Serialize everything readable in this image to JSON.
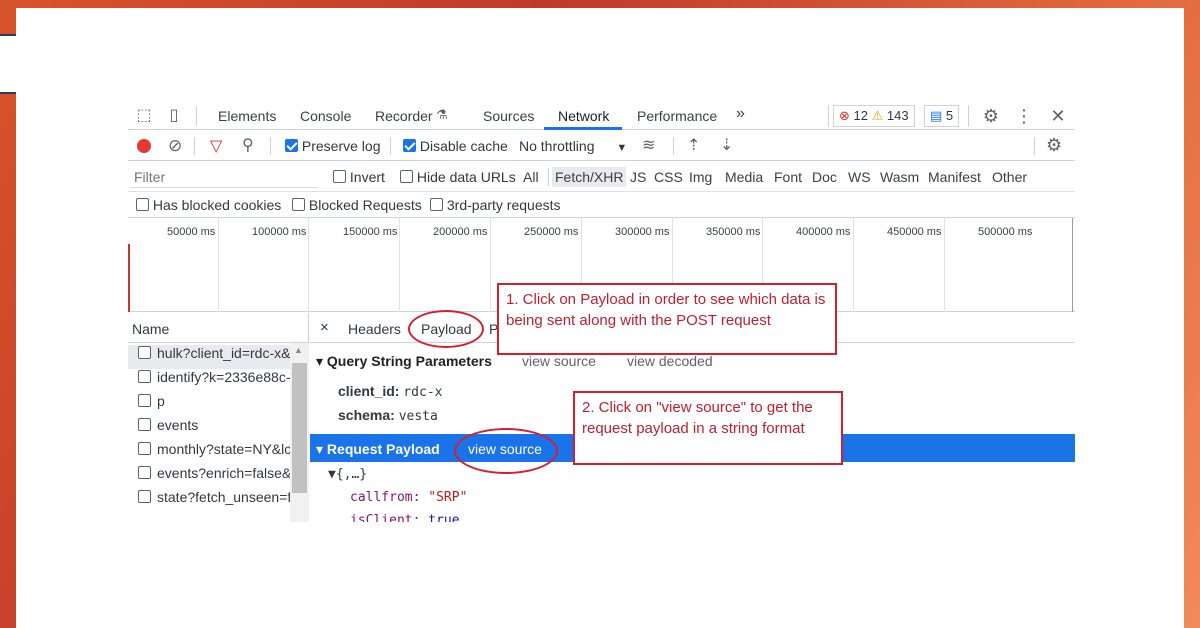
{
  "devtools": {
    "tabs": [
      "Elements",
      "Console",
      "Recorder",
      "Sources",
      "Network",
      "Performance"
    ],
    "active_tab": "Network",
    "more_tabs": "»",
    "errors_count": "12",
    "warnings_count": "143",
    "messages_count": "5",
    "toolbar": {
      "preserve_log": "Preserve log",
      "disable_cache": "Disable cache",
      "throttling": "No throttling"
    },
    "filter": {
      "placeholder": "Filter",
      "invert": "Invert",
      "hide_data_urls": "Hide data URLs",
      "types": [
        "All",
        "Fetch/XHR",
        "JS",
        "CSS",
        "Img",
        "Media",
        "Font",
        "Doc",
        "WS",
        "Wasm",
        "Manifest",
        "Other"
      ],
      "selected_type": "Fetch/XHR"
    },
    "row3": {
      "blocked_cookies": "Has blocked cookies",
      "blocked_requests": "Blocked Requests",
      "third_party": "3rd-party requests"
    },
    "timeline_ticks": [
      "50000 ms",
      "100000 ms",
      "150000 ms",
      "200000 ms",
      "250000 ms",
      "300000 ms",
      "350000 ms",
      "400000 ms",
      "450000 ms",
      "500000 ms"
    ],
    "name_header": "Name",
    "requests": [
      "hulk?client_id=rdc-x&",
      "identify?k=2336e88c-",
      "p",
      "events",
      "monthly?state=NY&lc",
      "events?enrich=false&",
      "state?fetch_unseen=fa"
    ],
    "detail_tabs": {
      "close": "×",
      "headers": "Headers",
      "payload": "Payload",
      "preview_partial": "P"
    },
    "query_section": {
      "title": "Query String Parameters",
      "view_source": "view source",
      "view_decoded": "view decoded",
      "params": [
        {
          "key": "client_id:",
          "value": "rdc-x"
        },
        {
          "key": "schema:",
          "value": "vesta"
        }
      ]
    },
    "payload_section": {
      "title": "Request Payload",
      "view_source": "view source",
      "tree_root": "▼{,…}",
      "lines": [
        {
          "key": "callfrom:",
          "value": "\"SRP\""
        },
        {
          "key": "isClient:",
          "value": "true"
        }
      ]
    }
  },
  "annotations": {
    "note1": "1. Click on Payload in order to see which data is being sent along with the POST request",
    "note2": "2. Click on \"view source\" to get the request payload in a string format"
  }
}
